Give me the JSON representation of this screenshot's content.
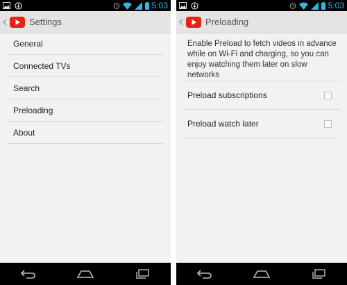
{
  "statusbar": {
    "time": "5:03"
  },
  "left_screen": {
    "title": "Settings",
    "items": [
      {
        "label": "General"
      },
      {
        "label": "Connected TVs"
      },
      {
        "label": "Search"
      },
      {
        "label": "Preloading"
      },
      {
        "label": "About"
      }
    ]
  },
  "right_screen": {
    "title": "Preloading",
    "description": "Enable Preload to fetch videos in advance while on Wi-Fi and charging, so you can enjoy watching them later on slow networks",
    "options": [
      {
        "label": "Preload subscriptions",
        "checked": false
      },
      {
        "label": "Preload watch later",
        "checked": false
      }
    ]
  },
  "colors": {
    "accent": "#33b5e5",
    "youtube_red": "#e62117"
  },
  "icons": [
    "image-icon",
    "download-notification-icon",
    "alarm-icon",
    "wifi-icon",
    "signal-icon",
    "battery-icon",
    "back-icon",
    "home-icon",
    "recent-apps-icon",
    "youtube-logo-icon"
  ]
}
